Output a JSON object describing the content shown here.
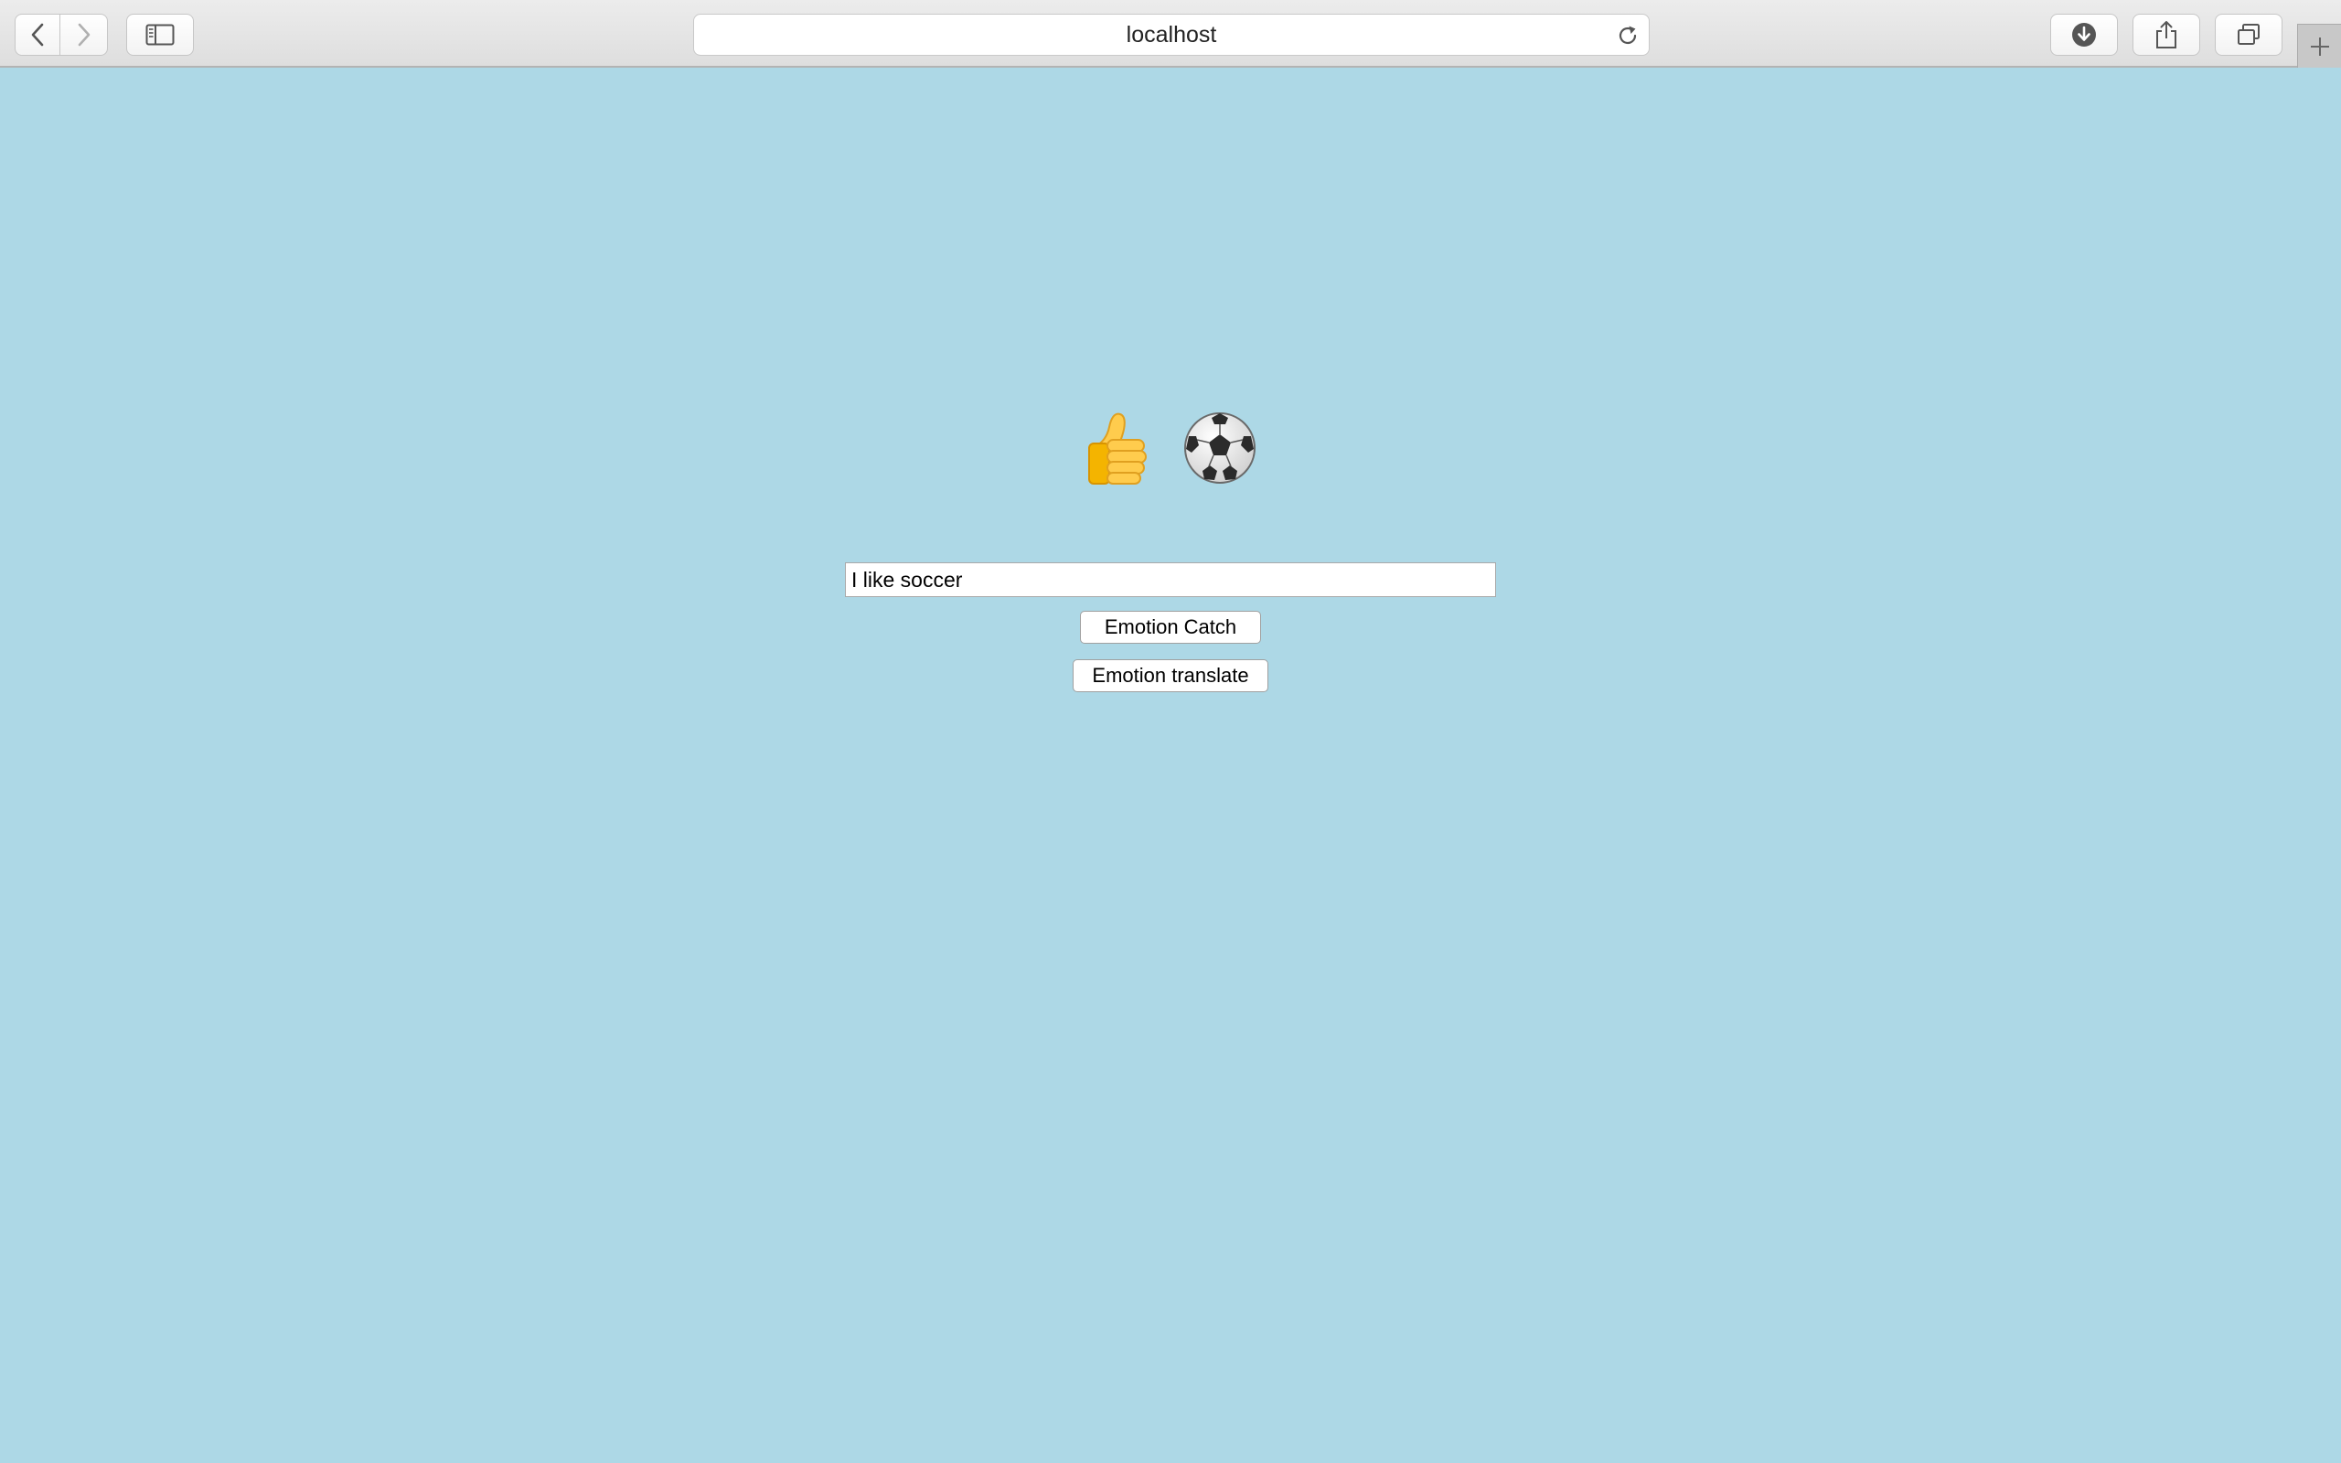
{
  "browser": {
    "address": "localhost",
    "icons": {
      "back": "chevron-left-icon",
      "forward": "chevron-right-icon",
      "sidebar": "sidebar-icon",
      "reload": "reload-icon",
      "download": "download-icon",
      "share": "share-icon",
      "tabs": "tabs-overview-icon",
      "new_tab": "plus-icon"
    }
  },
  "page": {
    "background_color": "#add8e6",
    "emojis": [
      "thumbs-up-icon",
      "soccer-ball-icon"
    ],
    "input_value": "I like soccer",
    "catch_button_label": "Emotion Catch",
    "translate_button_label": "Emotion translate"
  }
}
